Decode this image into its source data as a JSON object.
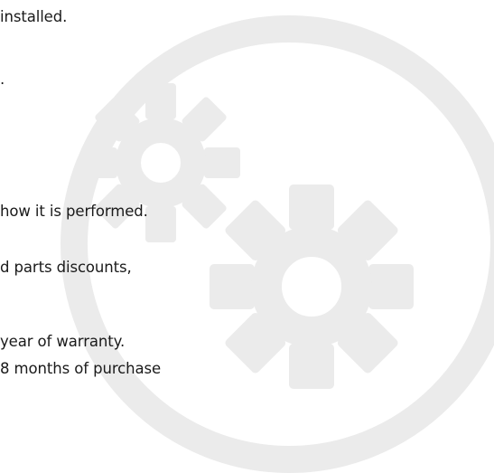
{
  "document": {
    "lines": [
      "installed.",
      ".",
      "how it is performed.",
      "d parts discounts,",
      "year of warranty.",
      "8 months of purchase"
    ]
  },
  "watermark": {
    "icon": "gears-icon",
    "color": "#ebebeb"
  }
}
